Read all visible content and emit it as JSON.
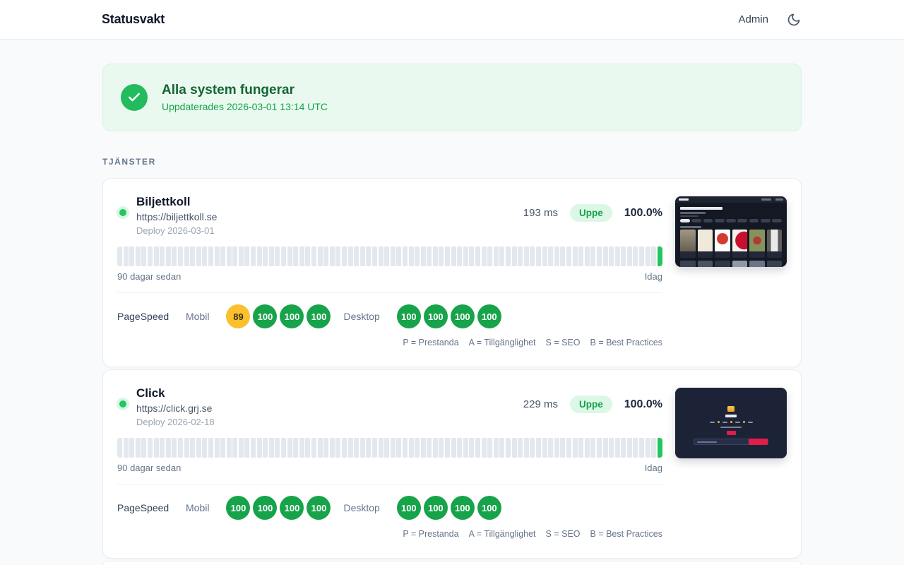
{
  "header": {
    "title": "Statusvakt",
    "admin_label": "Admin"
  },
  "banner": {
    "title": "Alla system fungerar",
    "updated": "Uppdaterades 2026-03-01 13:14 UTC"
  },
  "section_label": "TJÄNSTER",
  "uptime": {
    "days": 90,
    "left_label": "90 dagar sedan",
    "right_label": "Idag"
  },
  "pagespeed": {
    "label": "PageSpeed",
    "mobile_label": "Mobil",
    "desktop_label": "Desktop",
    "legend": [
      "P = Prestanda",
      "A = Tillgänglighet",
      "S = SEO",
      "B = Best Practices"
    ]
  },
  "services": [
    {
      "name": "Biljettkoll",
      "url": "https://biljettkoll.se",
      "deploy": "Deploy 2026-03-01",
      "response_time": "193 ms",
      "status": "Uppe",
      "uptime_pct": "100.0%",
      "mobile_scores": [
        89,
        100,
        100,
        100
      ],
      "desktop_scores": [
        100,
        100,
        100,
        100
      ]
    },
    {
      "name": "Click",
      "url": "https://click.grj.se",
      "deploy": "Deploy 2026-02-18",
      "response_time": "229 ms",
      "status": "Uppe",
      "uptime_pct": "100.0%",
      "mobile_scores": [
        100,
        100,
        100,
        100
      ],
      "desktop_scores": [
        100,
        100,
        100,
        100
      ]
    }
  ],
  "icons": {
    "theme_toggle": "moon-icon",
    "banner_status": "check-icon",
    "service_status": "green-dot"
  },
  "colors": {
    "status_up_green": "#22c55e",
    "accent_green": "#16a34a",
    "badge_bg": "#dcf7e6",
    "score_green": "#17a34a",
    "score_amber": "#fbc02d",
    "bar_gray": "#e3e7ee",
    "banner_bg": "#e9f9f0"
  }
}
